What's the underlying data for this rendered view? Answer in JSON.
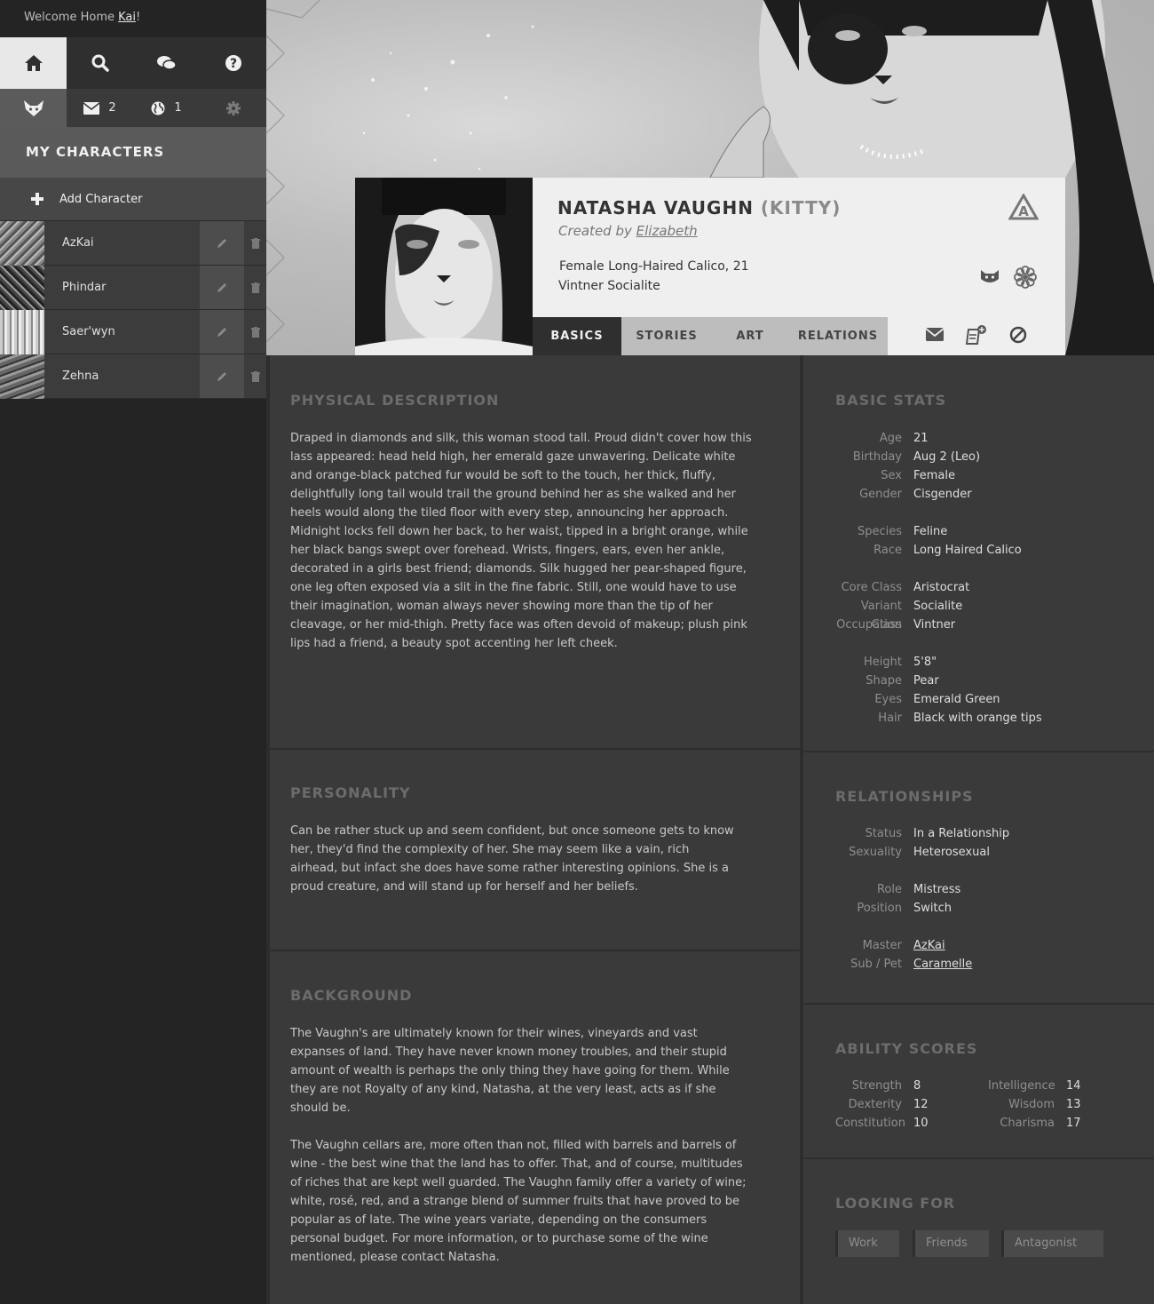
{
  "sidebar": {
    "welcome_prefix": "Welcome Home ",
    "welcome_user": "Kai",
    "welcome_suffix": "!",
    "mail_count": "2",
    "world_count": "1",
    "my_characters": "MY CHARACTERS",
    "add_character": "Add Character",
    "characters": [
      {
        "name": "AzKai"
      },
      {
        "name": "Phindar"
      },
      {
        "name": "Saer'wyn"
      },
      {
        "name": "Zehna"
      }
    ]
  },
  "profile": {
    "name": "NATASHA VAUGHN",
    "nickname": "(KITTY)",
    "created_by_label": "Created by",
    "creator": "Elizabeth",
    "summary_line1": "Female Long-Haired Calico, 21",
    "summary_line2": "Vintner Socialite"
  },
  "tabs": [
    {
      "label": "BASICS",
      "active": true
    },
    {
      "label": "STORIES",
      "active": false
    },
    {
      "label": "ART",
      "active": false
    },
    {
      "label": "RELATIONS",
      "active": false
    }
  ],
  "physical": {
    "title": "PHYSICAL DESCRIPTION",
    "text": "Draped in diamonds and silk, this woman stood tall. Proud didn't cover how this lass appeared: head held high, her emerald gaze unwavering. Delicate white and orange-black patched fur would be soft to the touch, her thick, fluffy, delightfully long tail would trail the ground behind her as she walked and her heels would along the tiled floor with every step, announcing her approach. Midnight locks fell down her back, to her waist, tipped in a bright orange, while her black bangs swept over forehead. Wrists, fingers, ears, even her ankle, decorated in a girls best friend; diamonds. Silk hugged her pear-shaped figure, one leg often exposed via a slit in the fine fabric. Still, one would have to use their imagination, woman always never showing more than the tip of her cleavage, or her mid-thigh. Pretty face was often devoid of makeup; plush pink lips had a friend, a beauty spot accenting her left cheek."
  },
  "personality": {
    "title": "PERSONALITY",
    "text": "Can be rather stuck up and seem confident, but once someone gets to know her, they'd find the complexity of her. She may seem like a vain, rich airhead, but infact she does have some rather interesting opinions. She is a proud creature, and will stand up for herself and her beliefs."
  },
  "background": {
    "title": "BACKGROUND",
    "p1": "The Vaughn's are ultimately known for their wines, vineyards and vast expanses of land. They have never known money troubles, and their stupid amount of wealth is perhaps the only thing they have going for them. While they are not Royalty of any kind, Natasha, at the very least, acts as if she should be.",
    "p2": "The Vaughn cellars are, more often than not, filled with barrels and barrels of wine - the best wine that the land has to offer. That, and of course, multitudes of riches that are kept well guarded. The Vaughn family offer a variety of wine; white, rosé, red, and a strange blend of summer fruits that have proved to be popular as of late. The wine years variate, depending on the consumers personal budget. For more information, or to purchase some of the wine mentioned, please contact Natasha."
  },
  "basic_stats": {
    "title": "BASIC STATS",
    "groups": [
      [
        [
          "Age",
          "21"
        ],
        [
          "Birthday",
          "Aug 2 (Leo)"
        ],
        [
          "Sex",
          "Female"
        ],
        [
          "Gender",
          "Cisgender"
        ]
      ],
      [
        [
          "Species",
          "Feline"
        ],
        [
          "Race",
          "Long Haired Calico"
        ]
      ],
      [
        [
          "Core Class",
          "Aristocrat"
        ],
        [
          "Variant Class",
          "Socialite"
        ],
        [
          "Occupation",
          "Vintner"
        ]
      ],
      [
        [
          "Height",
          "5'8\""
        ],
        [
          "Shape",
          "Pear"
        ],
        [
          "Eyes",
          "Emerald Green"
        ],
        [
          "Hair",
          "Black with orange tips"
        ]
      ]
    ]
  },
  "relationships": {
    "title": "RELATIONSHIPS",
    "groups": [
      [
        [
          "Status",
          "In a Relationship"
        ],
        [
          "Sexuality",
          "Heterosexual"
        ]
      ],
      [
        [
          "Role",
          "Mistress"
        ],
        [
          "Position",
          "Switch"
        ]
      ],
      [
        [
          "Master",
          "AzKai"
        ],
        [
          "Sub / Pet",
          "Caramelle"
        ]
      ]
    ]
  },
  "ability_scores": {
    "title": "ABILITY SCORES",
    "left": [
      [
        "Strength",
        "8"
      ],
      [
        "Dexterity",
        "12"
      ],
      [
        "Constitution",
        "10"
      ]
    ],
    "right": [
      [
        "Intelligence",
        "14"
      ],
      [
        "Wisdom",
        "13"
      ],
      [
        "Charisma",
        "17"
      ]
    ]
  },
  "looking_for": {
    "title": "LOOKING FOR",
    "tags": [
      "Work",
      "Friends",
      "Antagonist"
    ]
  }
}
